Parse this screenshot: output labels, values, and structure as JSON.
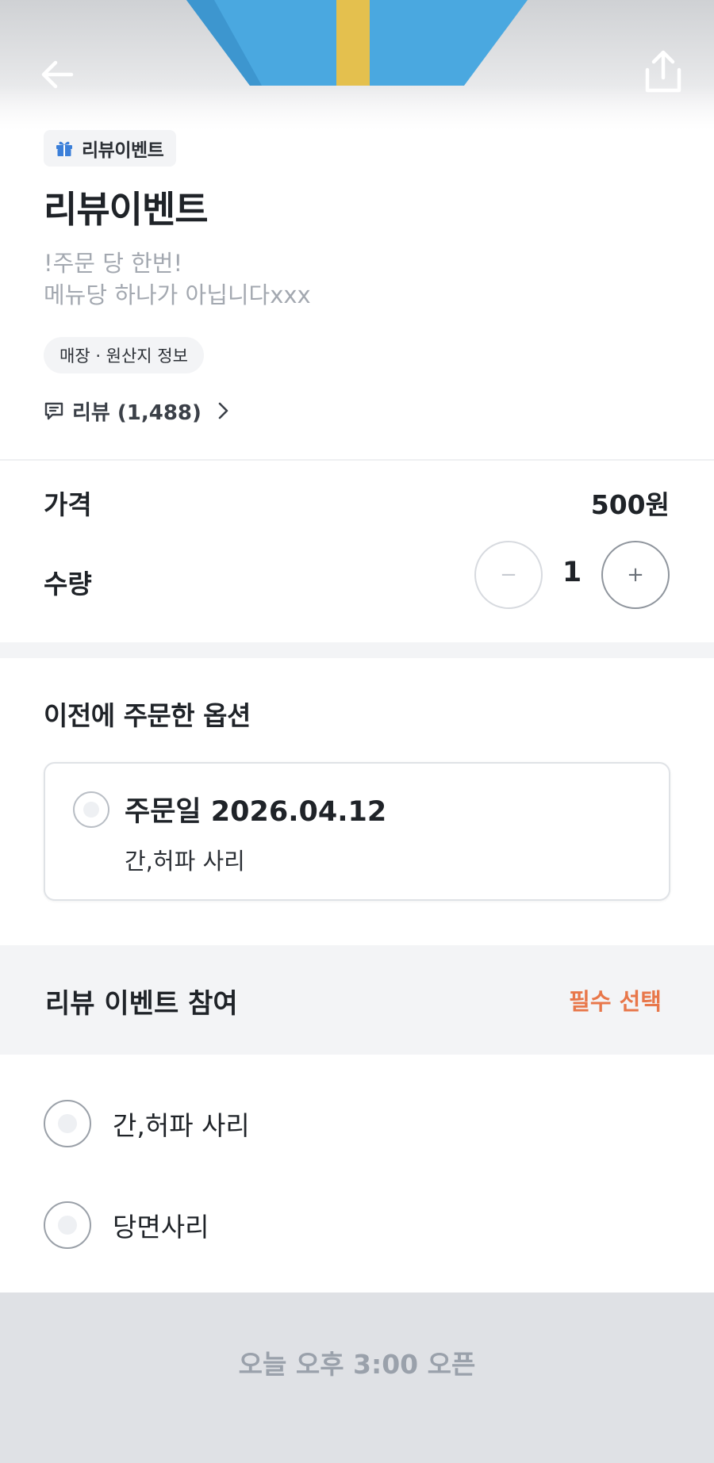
{
  "header": {
    "back_icon": "arrow-left-icon",
    "share_icon": "share-icon"
  },
  "product": {
    "badge_label": "리뷰이벤트",
    "title": "리뷰이벤트",
    "description_lines": [
      "!주문 당 한번!",
      "메뉴당 하나가 아닙니다xxx"
    ],
    "info_chip": "매장 · 원산지 정보",
    "review_label": "리뷰 (1,488)"
  },
  "price": {
    "label": "가격",
    "value": "500원"
  },
  "quantity": {
    "label": "수량",
    "value": "1",
    "minus": "−",
    "plus": "+"
  },
  "previous_options": {
    "title": "이전에 주문한 옵션",
    "order_date": "주문일 2026.04.12",
    "items": "간,허파 사리"
  },
  "review_event": {
    "title": "리뷰 이벤트 참여",
    "required_label": "필수 선택",
    "options": [
      "간,허파 사리",
      "당면사리"
    ]
  },
  "footer": {
    "button_label": "오늘 오후 3:00 오픈"
  },
  "colors": {
    "accent_required": "#e8774a",
    "footer_bg": "#dfe1e5",
    "hero_blue": "#4aa8e0",
    "hero_yellow": "#e9c451"
  }
}
